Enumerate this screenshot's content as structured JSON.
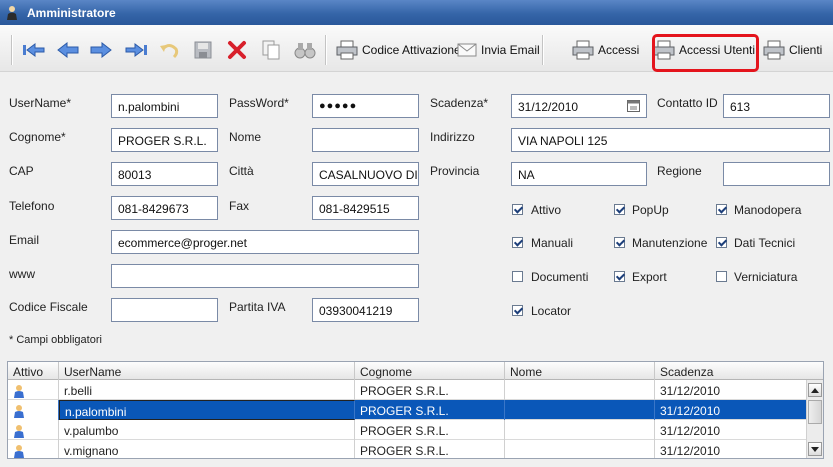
{
  "window": {
    "title": "Amministratore"
  },
  "toolbar": {
    "codice_attivazione": "Codice Attivazione",
    "invia_email": "Invia Email",
    "accessi": "Accessi",
    "accessi_utenti": "Accessi Utenti",
    "clienti": "Clienti"
  },
  "form": {
    "username_label": "UserName*",
    "username": "n.palombini",
    "password_label": "PassWord*",
    "password": "●●●●●",
    "scadenza_label": "Scadenza*",
    "scadenza": "31/12/2010",
    "contatto_label": "Contatto ID",
    "contatto": "613",
    "cognome_label": "Cognome*",
    "cognome": "PROGER S.R.L.",
    "nome_label": "Nome",
    "nome": "",
    "indirizzo_label": "Indirizzo",
    "indirizzo": "VIA NAPOLI 125",
    "cap_label": "CAP",
    "cap": "80013",
    "citta_label": "Città",
    "citta": "CASALNUOVO DI",
    "provincia_label": "Provincia",
    "provincia": "NA",
    "regione_label": "Regione",
    "regione": "",
    "telefono_label": "Telefono",
    "telefono": "081-8429673",
    "fax_label": "Fax",
    "fax": "081-8429515",
    "email_label": "Email",
    "email": "ecommerce@proger.net",
    "www_label": "www",
    "www": "",
    "codfisc_label": "Codice Fiscale",
    "codfisc": "",
    "piva_label": "Partita IVA",
    "piva": "03930041219",
    "required_note": "* Campi obbligatori"
  },
  "checks": {
    "attivo": "Attivo",
    "popup": "PopUp",
    "manodopera": "Manodopera",
    "manuali": "Manuali",
    "manutenzione": "Manutenzione",
    "dati_tecnici": "Dati Tecnici",
    "documenti": "Documenti",
    "export": "Export",
    "verniciatura": "Verniciatura",
    "locator": "Locator"
  },
  "grid": {
    "headers": [
      "Attivo",
      "UserName",
      "Cognome",
      "Nome",
      "Scadenza"
    ],
    "rows": [
      {
        "user": "r.belli",
        "cognome": "PROGER S.R.L.",
        "nome": "",
        "scadenza": "31/12/2010"
      },
      {
        "user": "n.palombini",
        "cognome": "PROGER S.R.L.",
        "nome": "",
        "scadenza": "31/12/2010"
      },
      {
        "user": "v.palumbo",
        "cognome": "PROGER S.R.L.",
        "nome": "",
        "scadenza": "31/12/2010"
      },
      {
        "user": "v.mignano",
        "cognome": "PROGER S.R.L.",
        "nome": "",
        "scadenza": "31/12/2010"
      }
    ]
  }
}
